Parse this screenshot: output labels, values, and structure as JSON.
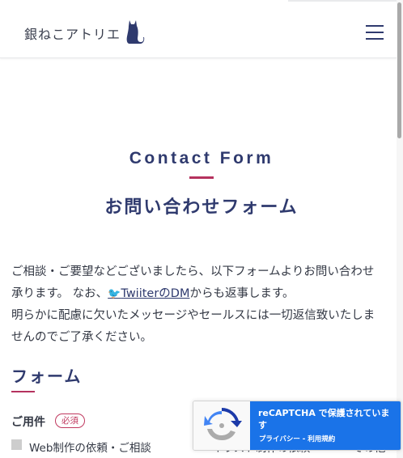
{
  "header": {
    "logo_text": "銀ねこアトリエ",
    "menu_icon": "hamburger-menu-icon",
    "logo_icon": "cat-silhouette-icon"
  },
  "colors": {
    "navy": "#2f3a6e",
    "accent": "#b5325e",
    "text": "#333844",
    "recaptcha_blue": "#1a73e8"
  },
  "main": {
    "heading_en": "Contact Form",
    "heading_ja": "お問い合わせフォーム",
    "intro": {
      "line1": "ご相談・ご要望などございましたら、以下フォームよりお問い合わせ",
      "line2_before": "承ります。 なお、",
      "twitter_icon_glyph": "🐦",
      "dm_link": "TwiiterのDM",
      "line2_after": "からも返事します。",
      "line3": "明らかに配慮に欠いたメッセージやセールスには一切返信致いたしま",
      "line4": "せんのでご了承ください。"
    }
  },
  "form": {
    "title": "フォーム",
    "field_label": "ご用件",
    "required_badge": "必須",
    "options": [
      {
        "label": "Web制作の依頼・ご相談"
      },
      {
        "label": "イラスト制作の依頼"
      },
      {
        "label": "その他"
      }
    ]
  },
  "recaptcha": {
    "title": "reCAPTCHA で保護されています",
    "privacy": "プライバシー",
    "separator": " - ",
    "terms": "利用規約"
  }
}
